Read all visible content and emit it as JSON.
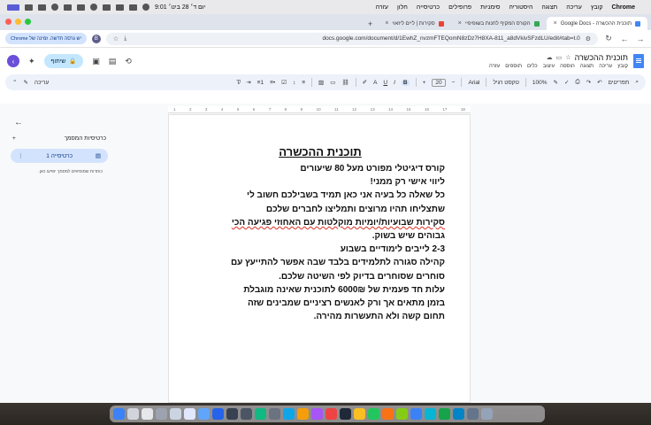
{
  "menubar": {
    "app_name": "Chrome",
    "items": [
      "קובץ",
      "עריכה",
      "תצוגה",
      "היסטוריה",
      "סימניות",
      "פרופילים",
      "כרטיסייה",
      "חלון",
      "עזרה"
    ],
    "clock": "יום ד׳ 28 בינו׳ 9:01"
  },
  "tabs": [
    {
      "label": "תוכנית ההכשרה - Google Docs",
      "active": true
    },
    {
      "label": "הקורס המקיף לחנות בשופיפיי",
      "active": false
    },
    {
      "label": "סקירות | ליים ליזאוי",
      "active": false
    }
  ],
  "address": {
    "url": "docs.google.com/document/d/1EwhZ_nvzmFTEQomN8zDz7H8XA-811_a8dVkivSFzdLU/edit#tab=t.0",
    "new_window_chip": "יש גרסה חדשה. זמינה של Chrome"
  },
  "docs": {
    "title": "תוכנית ההכשרה",
    "menus": [
      "קובץ",
      "עריכה",
      "תצוגה",
      "הוספה",
      "עיצוב",
      "כלים",
      "תוספים",
      "עזרה"
    ],
    "share_label": "שיתוף"
  },
  "toolbar": {
    "search_menus": "תפריטים",
    "zoom": "100%",
    "style": "טקסט רגיל",
    "font": "Arial",
    "font_size": "20",
    "mode": "עריכה"
  },
  "outline": {
    "header": "כרטיסיות המסמך",
    "tab_label": "כרטיסייה 1",
    "note": "כותרות שמוסיפים למסמך יופיעו כאן."
  },
  "document": {
    "heading": "תוכנית ההכשרה",
    "lines": [
      "קורס דיגיטלי מפורט מעל 80 שיעורים",
      "ליווי אישי רק ממני!",
      "כל שאלה כל בעיה אני כאן תמיד בשבילכם חשוב לי",
      "שתצליחו תהיו מרוצים ותמליצו לחברים שלכם",
      "סקירות שבועיות/יומיות מוקלטות עם האחוזי פגיעה הכי",
      "גבוהים שיש בשוק.",
      "2-3 לייבים לימודיים בשבוע",
      "קהילה סגורה לתלמידים בלבד שבה אפשר להתייעץ עם",
      "סוחרים שסוחרים בדיוק לפי השיטה שלכם.",
      "עלות חד פעמית של 6000₪ לתוכנית שאינה מוגבלת",
      "בזמן מתאים אך ורק לאנשים רציניים שמבינים שזה",
      "תחום קשה ולא התעשרות מהירה."
    ]
  }
}
